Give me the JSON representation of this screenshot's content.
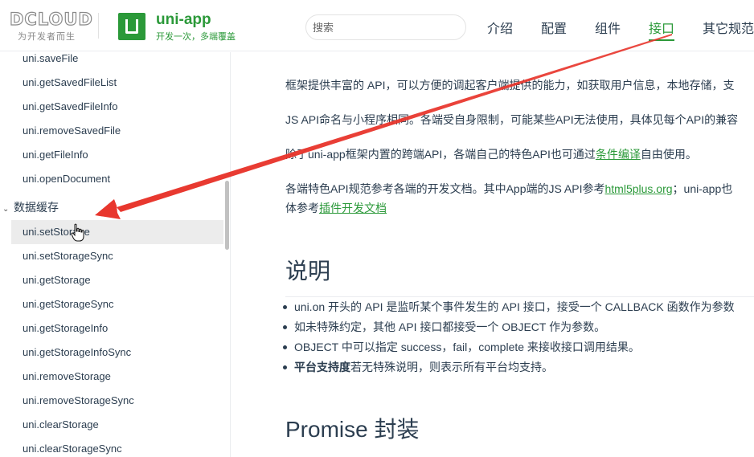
{
  "header": {
    "dcloud_logo_text": "DCLOUD",
    "dcloud_slogan": "为开发者而生",
    "uniapp_logo_letter": "U",
    "uniapp_name": "uni-app",
    "uniapp_slogan": "开发一次，多端覆盖",
    "search_placeholder": "搜索",
    "nav": [
      "介绍",
      "配置",
      "组件",
      "接口",
      "其它规范"
    ],
    "nav_active": "接口",
    "accent_color": "#2b9939"
  },
  "sidebar": {
    "items_before": [
      "uni.saveFile",
      "uni.getSavedFileList",
      "uni.getSavedFileInfo",
      "uni.removeSavedFile",
      "uni.getFileInfo",
      "uni.openDocument"
    ],
    "group_label": "数据缓存",
    "items_after": [
      "uni.setStorage",
      "uni.setStorageSync",
      "uni.getStorage",
      "uni.getStorageSync",
      "uni.getStorageInfo",
      "uni.getStorageInfoSync",
      "uni.removeStorage",
      "uni.removeStorageSync",
      "uni.clearStorage",
      "uni.clearStorageSync"
    ],
    "active_item": "uni.setStorage"
  },
  "main": {
    "p1": "框架提供丰富的 API，可以方便的调起客户端提供的能力，如获取用户信息，本地存储，支",
    "p2": "JS API命名与小程序相同。各端受自身限制，可能某些API无法使用，具体见每个API的兼容",
    "p3_before": "除了uni-app框架内置的跨端API，各端自己的特色API也可通过",
    "p3_link": "条件编译",
    "p3_after": "自由使用。",
    "p4_before": "各端特色API规范参考各端的开发文档。其中App端的JS API参考",
    "p4_link": "html5plus.org",
    "p4_after": "；uni-app也",
    "p4_line2_before": "体参考",
    "p4_line2_link": "插件开发文档",
    "h_explain": "说明",
    "bullets": [
      "uni.on 开头的 API 是监听某个事件发生的 API 接口，接受一个 CALLBACK 函数作为参数",
      "如未特殊约定，其他 API 接口都接受一个 OBJECT 作为参数。",
      "OBJECT 中可以指定 success，fail，complete 来接收接口调用结果。"
    ],
    "bullet4_bold": "平台支持度",
    "bullet4_rest": "若无特殊说明，则表示所有平台均支持。",
    "h_promise": "Promise 封装"
  },
  "annotation": {
    "arrow_color": "#e8362d"
  }
}
